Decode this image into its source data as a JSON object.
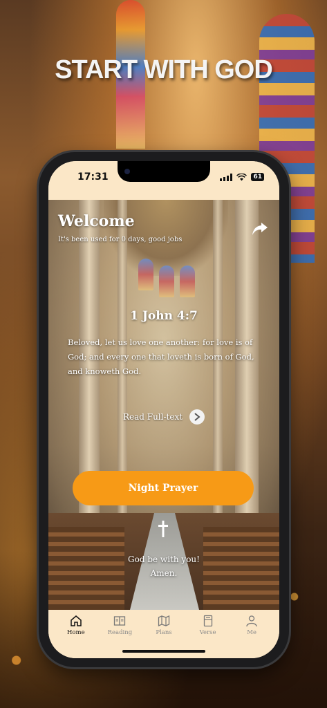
{
  "promo": {
    "headline": "START WITH GOD"
  },
  "status_bar": {
    "time": "17:31",
    "battery": "61"
  },
  "header": {
    "title": "Welcome",
    "usage_text": "It's been used for 0 days, good jobs"
  },
  "verse": {
    "reference": "1 John 4:7",
    "text": "Beloved, let us love one another: for love is of God; and every one that loveth is born of God, and knoweth God."
  },
  "read_full_label": "Read Full-text",
  "prayer_button_label": "Night Prayer",
  "blessing": {
    "line1": "God be with you!",
    "line2": "Amen."
  },
  "tabs": [
    {
      "label": "Home",
      "icon": "home-icon",
      "active": true
    },
    {
      "label": "Reading",
      "icon": "book-icon",
      "active": false
    },
    {
      "label": "Plans",
      "icon": "map-icon",
      "active": false
    },
    {
      "label": "Verse",
      "icon": "bookmark-icon",
      "active": false
    },
    {
      "label": "Me",
      "icon": "person-icon",
      "active": false
    }
  ],
  "colors": {
    "accent": "#f79a16",
    "tabbar_bg": "#fbe7c7"
  }
}
